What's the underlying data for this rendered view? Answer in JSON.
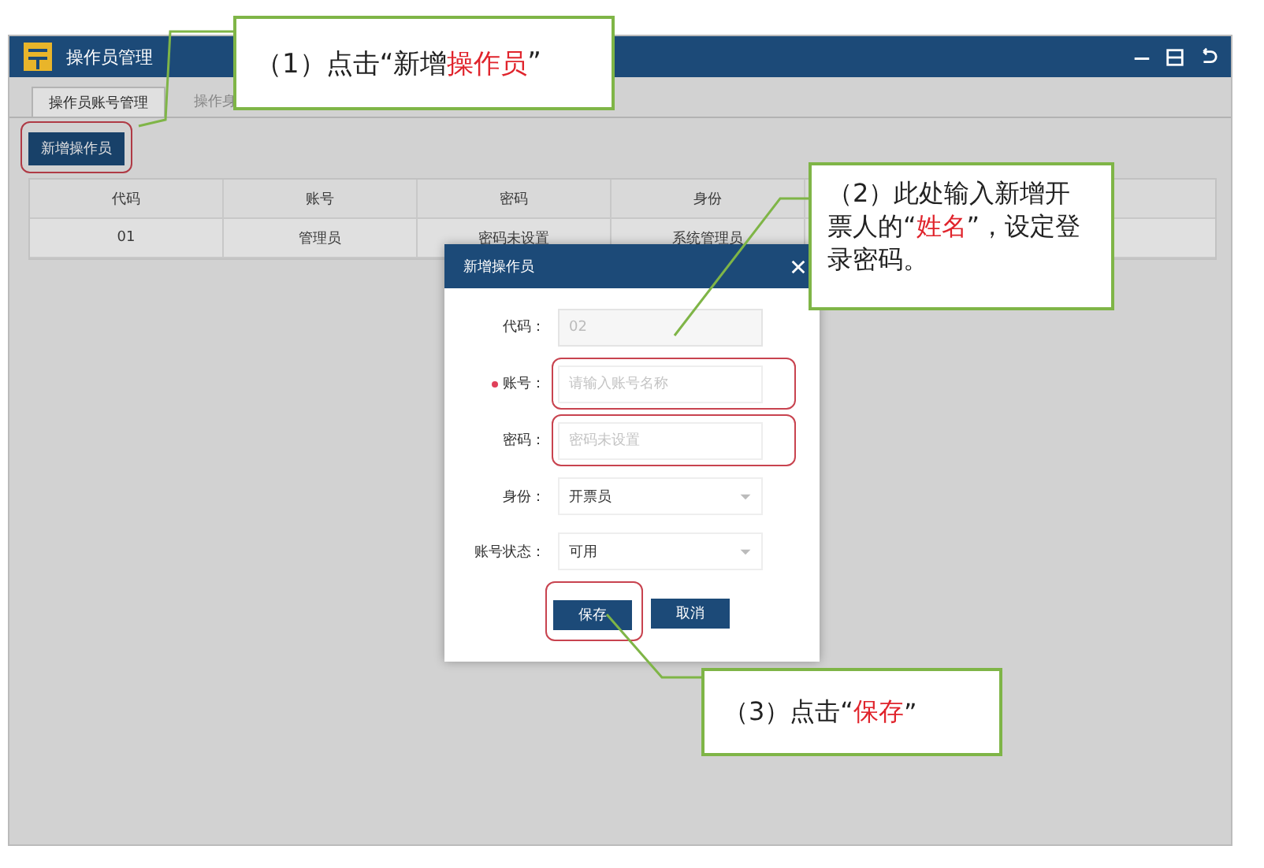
{
  "window": {
    "title": "操作员管理"
  },
  "tabs": [
    {
      "label": "操作员账号管理",
      "selected": true
    },
    {
      "label": "操作身",
      "selected": false
    }
  ],
  "add_button": {
    "label": "新增操作员",
    "highlighted": true
  },
  "table": {
    "columns": [
      "代码",
      "账号",
      "密码",
      "身份"
    ],
    "rows": [
      {
        "cells": [
          "01",
          "管理员",
          "密码未设置",
          "系统管理员"
        ]
      }
    ]
  },
  "dialog": {
    "title": "新增操作员",
    "fields": [
      {
        "label": "代码：",
        "kind": "text",
        "value": "02",
        "disabled": true,
        "required": false,
        "highlighted": false
      },
      {
        "label": "账号：",
        "kind": "text",
        "placeholder": "请输入账号名称",
        "disabled": false,
        "required": true,
        "highlighted": true
      },
      {
        "label": "密码：",
        "kind": "text",
        "placeholder": "密码未设置",
        "disabled": false,
        "required": false,
        "highlighted": true
      },
      {
        "label": "身份：",
        "kind": "select",
        "value": "开票员",
        "required": false,
        "highlighted": false
      },
      {
        "label": "账号状态：",
        "kind": "select",
        "value": "可用",
        "required": false,
        "highlighted": false
      }
    ],
    "buttons": [
      {
        "label": "保存",
        "highlighted": true
      },
      {
        "label": "取消",
        "highlighted": false
      }
    ]
  },
  "callouts": [
    {
      "parts": [
        {
          "text": "（1）点击“新增"
        },
        {
          "text": "操作员",
          "highlight": true
        },
        {
          "text": "”"
        }
      ]
    },
    {
      "parts": [
        {
          "text": "（2）此处输入新增开票人的“"
        },
        {
          "text": "姓名",
          "highlight": true
        },
        {
          "text": "”，设定登录密码。"
        }
      ]
    },
    {
      "parts": [
        {
          "text": "（3）点击“"
        },
        {
          "text": "保存",
          "highlight": true
        },
        {
          "text": "”"
        }
      ]
    }
  ]
}
